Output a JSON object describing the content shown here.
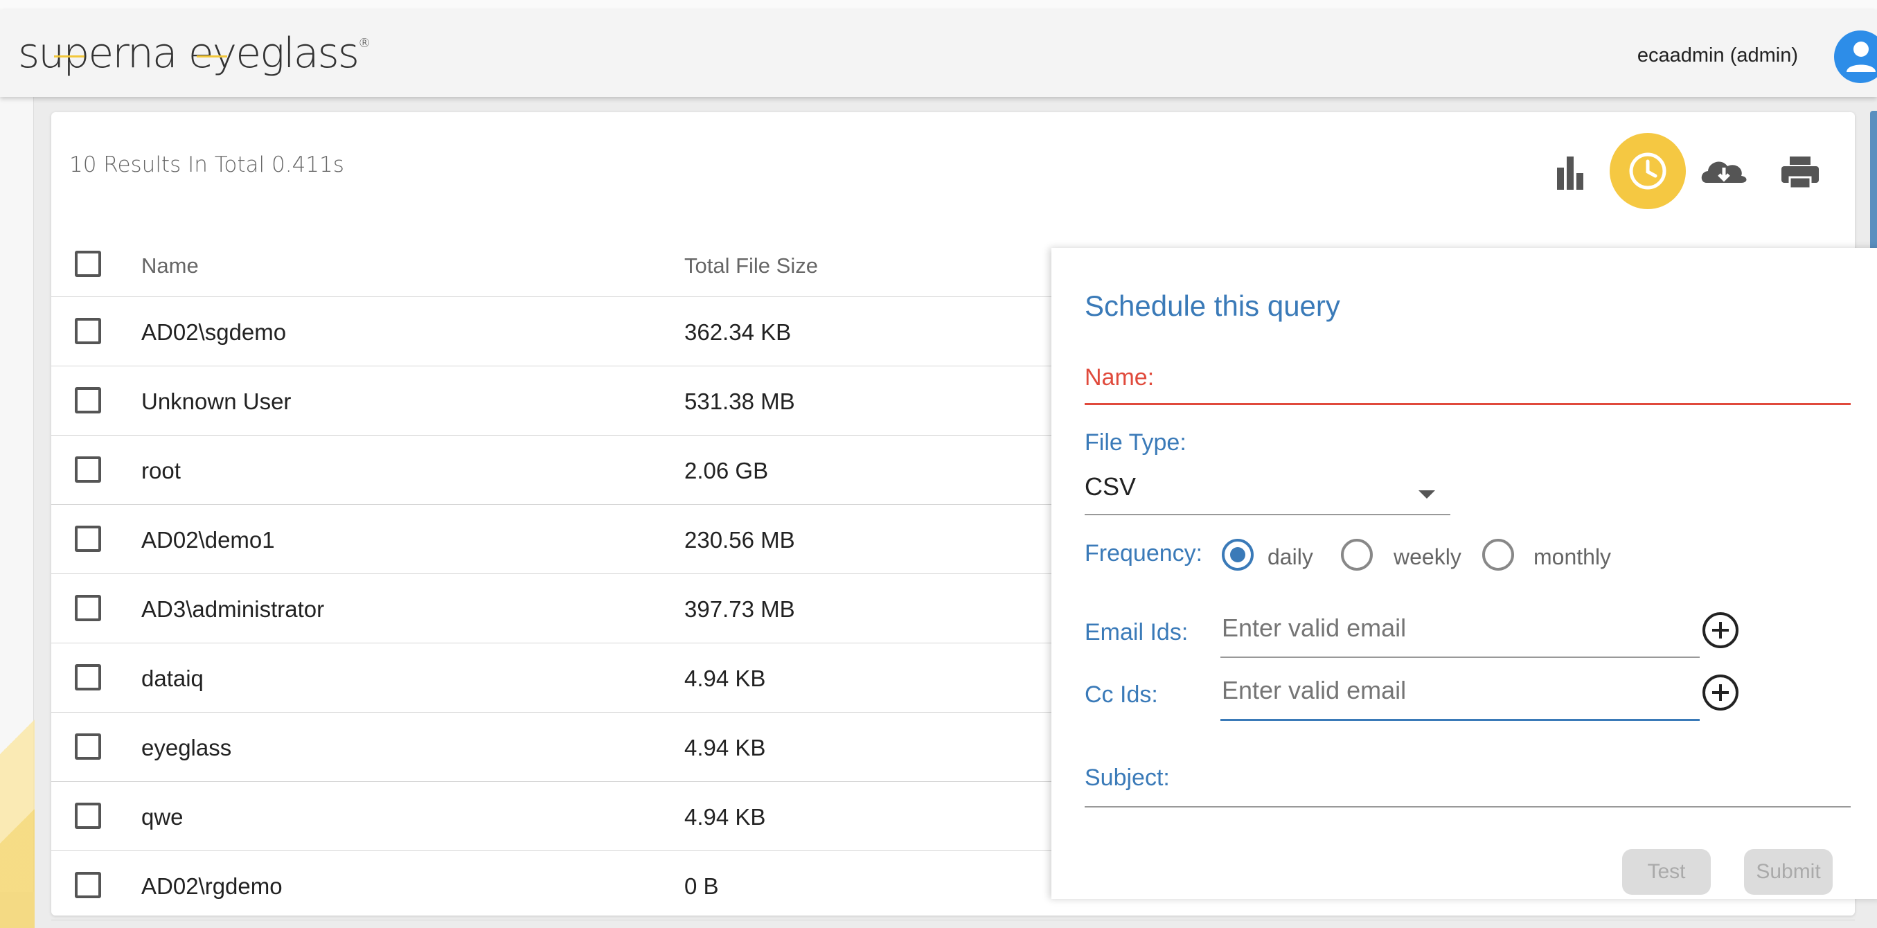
{
  "header": {
    "logo_text": "superna eyeglass",
    "logo_mark": "®",
    "user": "ecaadmin (admin)"
  },
  "toolbar": {
    "icons": [
      "bar-chart-icon",
      "clock-icon",
      "cloud-download-icon",
      "printer-icon"
    ],
    "accent": "#f5c842"
  },
  "results": {
    "summary": "10 Results In Total 0.411s"
  },
  "table": {
    "columns": [
      "Name",
      "Total File Size"
    ],
    "rows": [
      {
        "name": "AD02\\sgdemo",
        "size": "362.34 KB"
      },
      {
        "name": "Unknown User",
        "size": "531.38 MB"
      },
      {
        "name": "root",
        "size": "2.06 GB"
      },
      {
        "name": "AD02\\demo1",
        "size": "230.56 MB"
      },
      {
        "name": "AD3\\administrator",
        "size": "397.73 MB"
      },
      {
        "name": "dataiq",
        "size": "4.94 KB"
      },
      {
        "name": "eyeglass",
        "size": "4.94 KB"
      },
      {
        "name": "qwe",
        "size": "4.94 KB"
      },
      {
        "name": "AD02\\rgdemo",
        "size": "0 B"
      }
    ]
  },
  "schedule": {
    "title": "Schedule this query",
    "name_label": "Name:",
    "file_type_label": "File Type:",
    "file_type_value": "CSV",
    "frequency_label": "Frequency:",
    "frequency_options": [
      "daily",
      "weekly",
      "monthly"
    ],
    "frequency_selected": "daily",
    "email_label": "Email Ids:",
    "email_placeholder": "Enter valid email",
    "cc_label": "Cc Ids:",
    "cc_placeholder": "Enter valid email",
    "subject_label": "Subject:",
    "test_label": "Test",
    "submit_label": "Submit"
  },
  "colors": {
    "primary": "#3a7ab8",
    "error": "#e04a3c",
    "avatar": "#2d8de8"
  }
}
